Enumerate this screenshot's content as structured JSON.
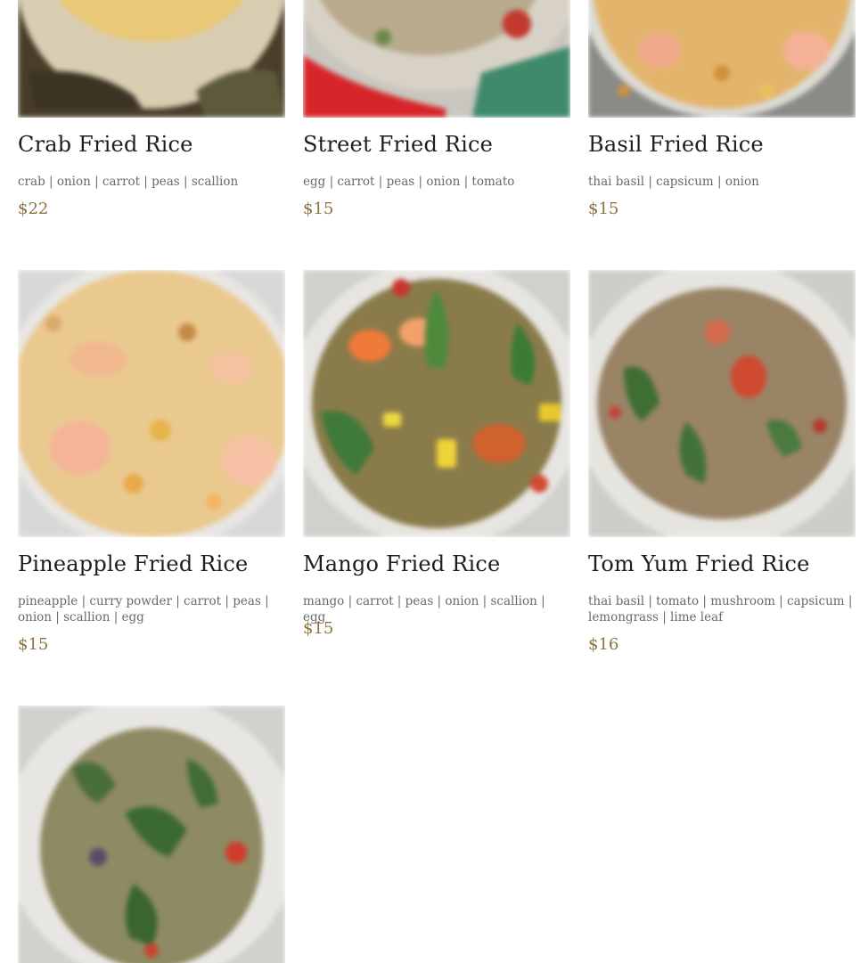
{
  "menu": {
    "items": [
      {
        "name": "Crab Fried Rice",
        "ingredients": "crab | onion | carrot | peas | scallion",
        "price": "$22",
        "photo_icon": "fried-rice-photo"
      },
      {
        "name": "Street Fried Rice",
        "ingredients": "egg | carrot | peas | onion | tomato",
        "price": "$15",
        "photo_icon": "fried-rice-photo"
      },
      {
        "name": "Basil Fried Rice",
        "ingredients": "thai basil | capsicum | onion",
        "price": "$15",
        "photo_icon": "fried-rice-photo"
      },
      {
        "name": "Pineapple Fried Rice",
        "ingredients": "pineapple | curry powder | carrot | peas | onion | scallion | egg",
        "price": "$15",
        "photo_icon": "fried-rice-photo"
      },
      {
        "name": "Mango Fried Rice",
        "ingredients": "mango | carrot | peas | onion | scallion | egg",
        "price": "$15",
        "photo_icon": "fried-rice-photo"
      },
      {
        "name": "Tom Yum Fried Rice",
        "ingredients": "thai basil | tomato | mushroom | capsicum | lemongrass | lime leaf",
        "price": "$16",
        "photo_icon": "fried-rice-photo"
      },
      {
        "name": "",
        "ingredients": "",
        "price": "",
        "photo_icon": "fried-rice-photo"
      }
    ]
  },
  "colors": {
    "title": "#1e1e1e",
    "ingredients": "#6a6a6a",
    "price": "#8a7340"
  }
}
